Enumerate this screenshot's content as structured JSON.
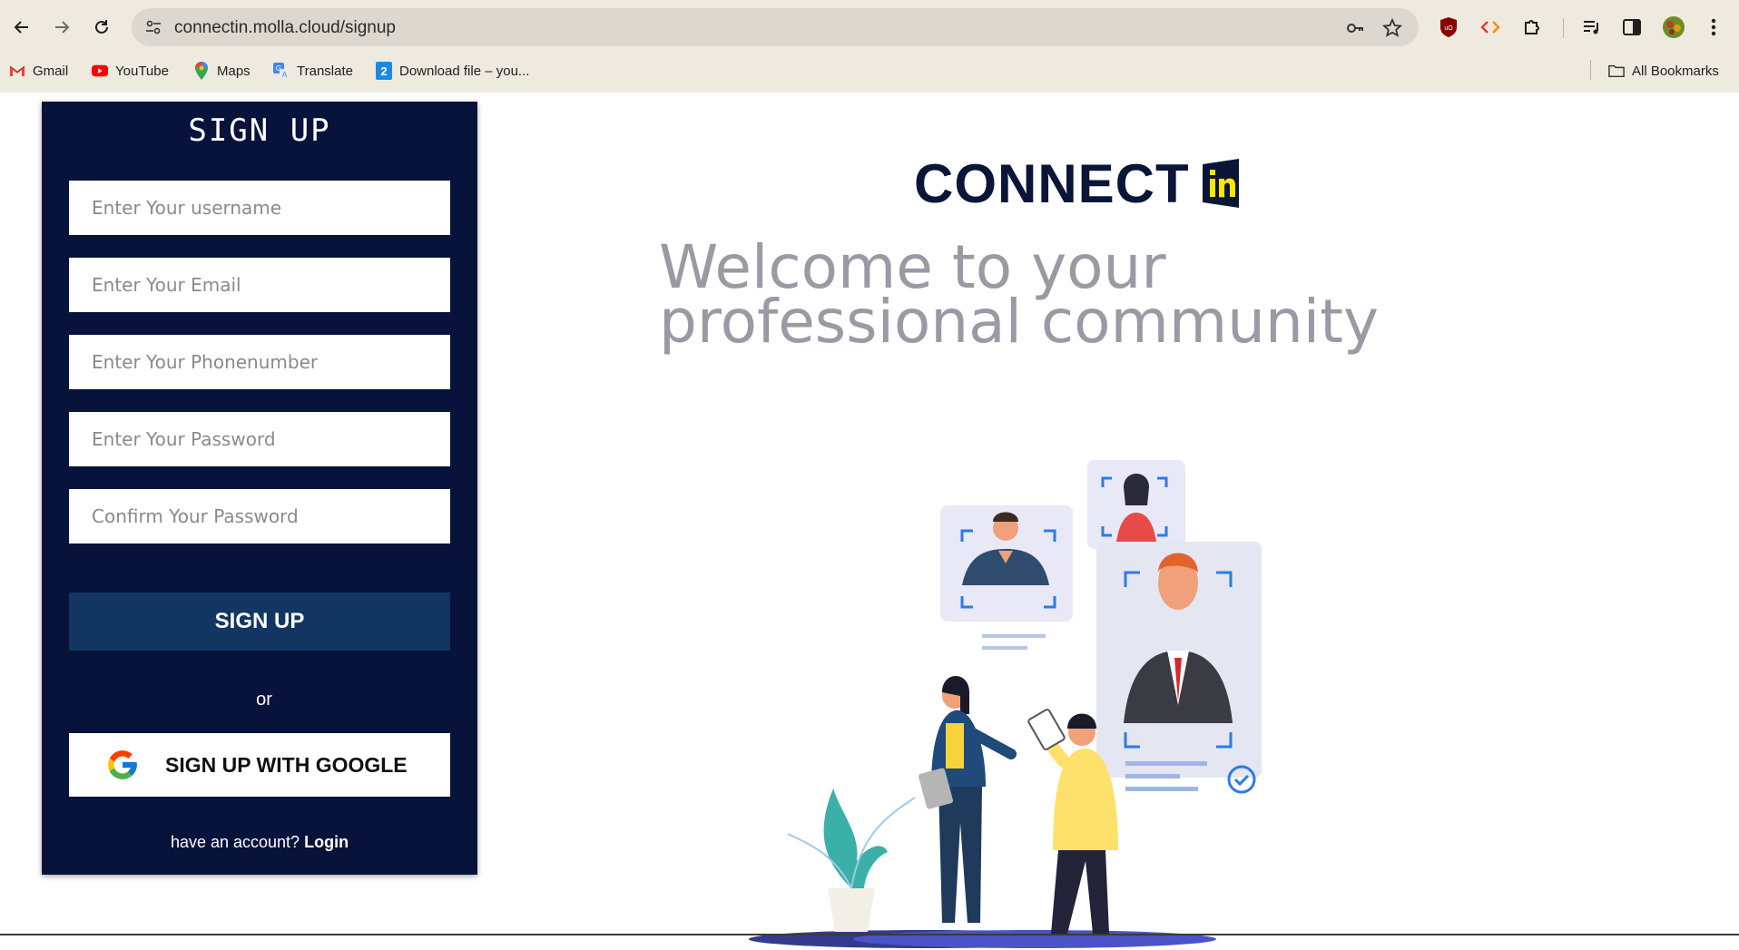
{
  "browser": {
    "url": "connectin.molla.cloud/signup",
    "bookmarks": [
      {
        "label": "Gmail",
        "icon": "gmail-icon"
      },
      {
        "label": "YouTube",
        "icon": "youtube-icon"
      },
      {
        "label": "Maps",
        "icon": "maps-icon"
      },
      {
        "label": "Translate",
        "icon": "translate-icon"
      },
      {
        "label": "Download file – you...",
        "icon": "download-file-icon"
      }
    ],
    "all_bookmarks": "All Bookmarks"
  },
  "signup": {
    "title": "SIGN UP",
    "username_placeholder": "Enter Your username",
    "email_placeholder": "Enter Your Email",
    "phone_placeholder": "Enter Your Phonenumber",
    "password_placeholder": "Enter Your Password",
    "confirm_placeholder": "Confirm Your Password",
    "submit_label": "SIGN UP",
    "or_text": "or",
    "google_label": "SIGN UP WITH GOOGLE",
    "account_prompt": "have an account?",
    "login_label": "Login"
  },
  "hero": {
    "logo_text": "CONNECT",
    "headline": "Welcome to your professional community"
  },
  "colors": {
    "panel": "#07133b",
    "signup_button": "#133561",
    "logo_badge": "#0b1538",
    "logo_badge_accent": "#ffe600",
    "headline": "#9a9aa4"
  }
}
